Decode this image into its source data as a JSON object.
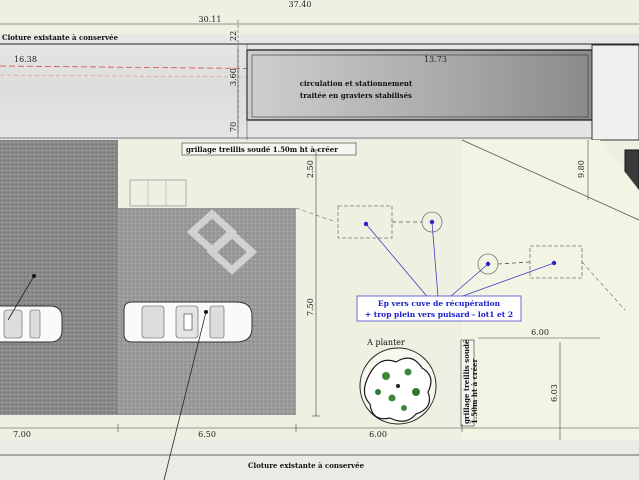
{
  "dimensions": {
    "top_total": "37.40",
    "top_30_11": "30.11",
    "d16_38": "16.38",
    "d13_73": "13.73",
    "d22": "22",
    "d3_60": "3.60",
    "d70": "70",
    "d2_50": "2.50",
    "d7_50": "7.50",
    "d9_80": "9.80",
    "d6_00_right": "6.00",
    "d6_03": "6.03",
    "d7_00": "7.00",
    "d6_50": "6.50",
    "d6_00_bottom": "6.00"
  },
  "labels": {
    "cloture_top": "Cloture existante à conservée",
    "circulation_line1": "circulation et stationnement",
    "circulation_line2": "traitée en graviers stabilisés",
    "grillage_top": "grillage treillis soudé 1.50m ht à créer",
    "ep_line1": "Ep vers cuve de récupération",
    "ep_line2": "+ trop plein vers puisard - lot1 et 2",
    "a_planter": "A planter",
    "grillage_vert1": "grillage treillis soudé",
    "grillage_vert2": "1.50m ht à créer",
    "cloture_bottom": "Cloture existante à conservée"
  },
  "colors": {
    "callout_blue": "#1a1ad0",
    "dashed_red": "#d05050",
    "gravel_grey": "#8a8a8a",
    "lawn": "#eef0e2",
    "tree_green": "#3a8a3a"
  }
}
